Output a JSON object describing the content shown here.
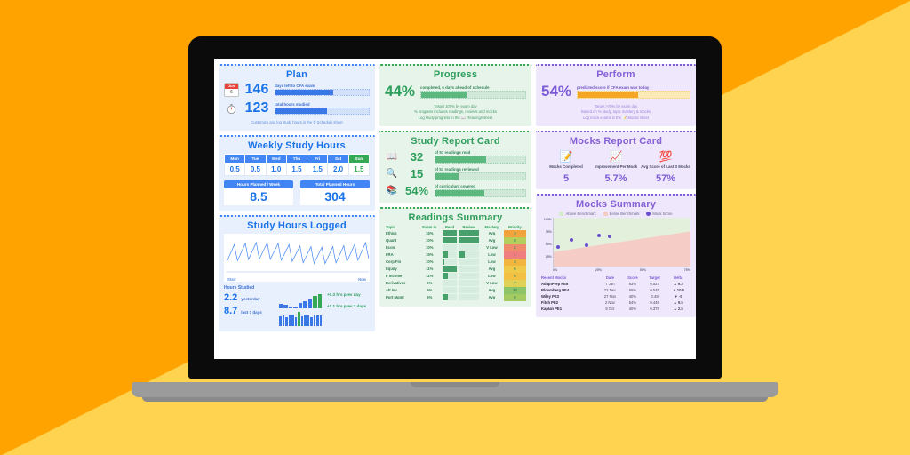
{
  "background": {
    "color_top": "#FFD34F",
    "color_bottom": "#FFA300"
  },
  "plan": {
    "title": "Plan",
    "calendar_icon": "calendar-icon",
    "calendar_month": "Jun",
    "calendar_day": "6",
    "timer_icon": "stopwatch-icon",
    "days_left_value": "146",
    "days_left_label": "days left to CFA exam",
    "days_left_pct": 62,
    "hours_studied_value": "123",
    "hours_studied_label": "total hours studied",
    "hours_studied_pct": 55,
    "footer": "Customize and log study hours in the ⏱ Schedule sheet"
  },
  "weekly": {
    "title": "Weekly Study Hours",
    "days": [
      "Mon",
      "Tue",
      "Wed",
      "Thu",
      "Fri",
      "Sat",
      "Sun"
    ],
    "hours": [
      "0.5",
      "0.5",
      "1.0",
      "1.5",
      "1.5",
      "2.0",
      "1.5"
    ],
    "planned_week_label": "Hours Planned / Week",
    "planned_week_value": "8.5",
    "total_planned_label": "Total Planned Hours",
    "total_planned_value": "304"
  },
  "logged": {
    "title": "Study Hours Logged",
    "axis_start": "Start",
    "axis_now": "Now",
    "section_label": "Hours Studied",
    "yesterday_value": "2.2",
    "yesterday_label": "yesterday",
    "last7_value": "8.7",
    "last7_label": "last 7 days",
    "delta_day": "+0.3 hrs prev day",
    "delta_week": "+1.1 hrs prev 7 days"
  },
  "progress": {
    "title": "Progress",
    "pct": "44%",
    "pct_value": 44,
    "label": "completed, 6 days ahead of schedule",
    "note1": "Target 100% by exam day",
    "note2": "% progress includes readings, reviews and mocks",
    "note3": "Log study progress in the 📖 Readings sheet"
  },
  "study_report": {
    "title": "Study Report Card",
    "rows": [
      {
        "icon": "book-icon",
        "glyph": "📖",
        "value": "32",
        "label": "of 57 readings read",
        "pct": 56
      },
      {
        "icon": "magnifier-icon",
        "glyph": "🔍",
        "value": "15",
        "label": "of 57 readings reviewed",
        "pct": 26
      },
      {
        "icon": "books-icon",
        "glyph": "📚",
        "value": "54%",
        "label": "of curriculum covered",
        "pct": 54
      }
    ]
  },
  "readings": {
    "title": "Readings Summary",
    "columns": [
      "Topic",
      "Exam %",
      "Read",
      "Review",
      "Mastery",
      "Priority"
    ],
    "rows": [
      {
        "topic": "Ethics",
        "exam": "15%",
        "read": 100,
        "review": 100,
        "mastery": "Avg",
        "priority": "3",
        "prio_color": "#f3a33c"
      },
      {
        "topic": "Quant",
        "exam": "10%",
        "read": 100,
        "review": 100,
        "mastery": "Avg",
        "priority": "8",
        "prio_color": "#b6cf5a"
      },
      {
        "topic": "Econ",
        "exam": "10%",
        "read": 0,
        "review": 0,
        "mastery": "V Low",
        "priority": "2",
        "prio_color": "#f08a6c"
      },
      {
        "topic": "FRA",
        "exam": "15%",
        "read": 36,
        "review": 28,
        "mastery": "Low",
        "priority": "1",
        "prio_color": "#ef7e7e"
      },
      {
        "topic": "Corp Fin",
        "exam": "10%",
        "read": 12,
        "review": 0,
        "mastery": "Low",
        "priority": "4",
        "prio_color": "#f2b53f"
      },
      {
        "topic": "Equity",
        "exam": "11%",
        "read": 100,
        "review": 0,
        "mastery": "Avg",
        "priority": "6",
        "prio_color": "#f0c94a"
      },
      {
        "topic": "F Income",
        "exam": "11%",
        "read": 36,
        "review": 0,
        "mastery": "Low",
        "priority": "5",
        "prio_color": "#f2c043"
      },
      {
        "topic": "Derivatives",
        "exam": "6%",
        "read": 0,
        "review": 0,
        "mastery": "V Low",
        "priority": "7",
        "prio_color": "#dfd155"
      },
      {
        "topic": "Alt Inv",
        "exam": "6%",
        "read": 0,
        "review": 0,
        "mastery": "Avg",
        "priority": "10",
        "prio_color": "#8cc46a"
      },
      {
        "topic": "Port Mgmt",
        "exam": "6%",
        "read": 36,
        "review": 0,
        "mastery": "Avg",
        "priority": "9",
        "prio_color": "#a3cb61"
      }
    ]
  },
  "perform": {
    "title": "Perform",
    "pct": "54%",
    "pct_value": 54,
    "label": "predicted score if CFA exam was today",
    "note1": "Target >70% by exam day",
    "note2": "Based on % study, topic mastery & mocks",
    "note3": "Log mock exams in the 📝 Mocks sheet"
  },
  "mocks_report": {
    "title": "Mocks Report Card",
    "cards": [
      {
        "icon": "pencil-note-icon",
        "glyph": "📝",
        "label": "Mocks Completed",
        "value": "5"
      },
      {
        "icon": "chart-up-icon",
        "glyph": "📈",
        "label": "Improvement Per Mock",
        "value": "5.7%"
      },
      {
        "icon": "hundred-points-icon",
        "glyph": "💯",
        "label": "Avg Score of Last 3 Mocks",
        "value": "57%"
      }
    ]
  },
  "chart_data": {
    "type": "scatter",
    "title": "Mocks Summary",
    "xlabel": "",
    "ylabel": "",
    "xlim": [
      0,
      100
    ],
    "ylim": [
      0,
      100
    ],
    "xticks": [
      "0%",
      "25%",
      "50%",
      "75%"
    ],
    "yticks": [
      "100%",
      "75%",
      "50%",
      "25%"
    ],
    "legend": [
      {
        "label": "Above Benchmark",
        "color": "#d6ebcb"
      },
      {
        "label": "Below Benchmark",
        "color": "#f6cdc6"
      },
      {
        "label": "Mock Score",
        "color": "#6b4fd0"
      }
    ],
    "legend_position": "top",
    "grid": false,
    "series": [
      {
        "name": "Mock Score",
        "points": [
          {
            "x": 3,
            "y": 40
          },
          {
            "x": 13,
            "y": 54
          },
          {
            "x": 24,
            "y": 43
          },
          {
            "x": 33,
            "y": 63
          },
          {
            "x": 41,
            "y": 61
          }
        ]
      }
    ],
    "benchmark_line": {
      "start_y": 30,
      "end_y": 72
    }
  },
  "recent_mocks": {
    "columns": [
      "Recent Mocks",
      "Date",
      "Score",
      "Target",
      "Delta"
    ],
    "rows": [
      {
        "name": "AdaptPrep PE5",
        "date": "7 Jan",
        "score": "63%",
        "target": "0.537",
        "delta": "9.3",
        "dir": "up"
      },
      {
        "name": "Bloomberg PE4",
        "date": "22 Dec",
        "score": "65%",
        "target": "0.545",
        "delta": "10.5",
        "dir": "up"
      },
      {
        "name": "Wiley PE3",
        "date": "27 Nov",
        "score": "40%",
        "target": "0.49",
        "delta": "-9",
        "dir": "down"
      },
      {
        "name": "Fitch PE2",
        "date": "2 Nov",
        "score": "54%",
        "target": "0.445",
        "delta": "9.5",
        "dir": "up"
      },
      {
        "name": "Kaplan PE1",
        "date": "8 Oct",
        "score": "40%",
        "target": "0.375",
        "delta": "2.5",
        "dir": "up"
      }
    ]
  }
}
